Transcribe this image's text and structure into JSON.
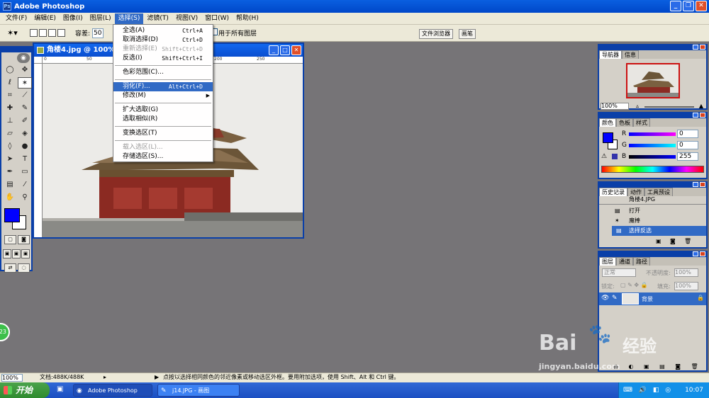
{
  "app": {
    "title": "Adobe Photoshop"
  },
  "menubar": {
    "items": [
      "文件(F)",
      "编辑(E)",
      "图像(I)",
      "图层(L)",
      "选择(S)",
      "滤镜(T)",
      "视图(V)",
      "窗口(W)",
      "帮助(H)"
    ]
  },
  "options": {
    "tolerance_label": "容差:",
    "tolerance_value": "50",
    "all_layers_label": "用于所有图层",
    "file_browser_tab": "文件浏览器",
    "brush_tab": "画笔"
  },
  "document": {
    "title": "角楼4.jpg @ 100%",
    "ruler_labels": [
      "0",
      "50",
      "100",
      "150",
      "200",
      "250"
    ]
  },
  "select_menu": {
    "items": [
      {
        "label": "全选(A)",
        "shortcut": "Ctrl+A",
        "state": "normal"
      },
      {
        "label": "取消选择(D)",
        "shortcut": "Ctrl+D",
        "state": "normal"
      },
      {
        "label": "重新选择(E)",
        "shortcut": "Shift+Ctrl+D",
        "state": "disabled"
      },
      {
        "label": "反选(I)",
        "shortcut": "Shift+Ctrl+I",
        "state": "normal"
      },
      {
        "label": "色彩范围(C)...",
        "shortcut": "",
        "state": "normal"
      },
      {
        "label": "羽化(F)...",
        "shortcut": "Alt+Ctrl+D",
        "state": "highlight"
      },
      {
        "label": "修改(M)",
        "shortcut": "",
        "state": "submenu"
      },
      {
        "label": "扩大选取(G)",
        "shortcut": "",
        "state": "normal"
      },
      {
        "label": "选取相似(R)",
        "shortcut": "",
        "state": "normal"
      },
      {
        "label": "变换选区(T)",
        "shortcut": "",
        "state": "normal"
      },
      {
        "label": "载入选区(L)...",
        "shortcut": "",
        "state": "disabled"
      },
      {
        "label": "存储选区(S)...",
        "shortcut": "",
        "state": "normal"
      }
    ]
  },
  "navigator": {
    "tabs": [
      "导航器",
      "信息"
    ],
    "zoom": "100%"
  },
  "color_panel": {
    "tabs": [
      "颜色",
      "色板",
      "样式"
    ],
    "channels": [
      {
        "label": "R",
        "value": "0"
      },
      {
        "label": "G",
        "value": "0"
      },
      {
        "label": "B",
        "value": "255"
      }
    ],
    "foreground": "#0000FF"
  },
  "history_panel": {
    "tabs": [
      "历史记录",
      "动作",
      "工具预设"
    ],
    "snapshot": "角楼4.JPG",
    "items": [
      "打开",
      "魔棒",
      "选择反选"
    ]
  },
  "layers_panel": {
    "tabs": [
      "图层",
      "通道",
      "路径"
    ],
    "blend_mode": "正常",
    "opacity_label": "不透明度:",
    "opacity_value": "100%",
    "lock_label": "锁定:",
    "fill_label": "填充:",
    "fill_value": "100%",
    "layer_name": "背景"
  },
  "statusbar": {
    "zoom": "100%",
    "doc_size": "文档:488K/488K",
    "hint": "点按以选择相同颜色的邻近像素或移动选区外框。要用附加选项，使用 Shift、Alt 和 Ctrl 键。"
  },
  "taskbar": {
    "start_label": "开始",
    "tasks": [
      "Adobe Photoshop",
      "j14.JPG - 画图"
    ],
    "clock": "10:07"
  },
  "overlay": {
    "badge": "23",
    "watermark_brand": "Bai",
    "watermark_cn": "经验",
    "watermark_url": "jingyan.baidu.com"
  }
}
